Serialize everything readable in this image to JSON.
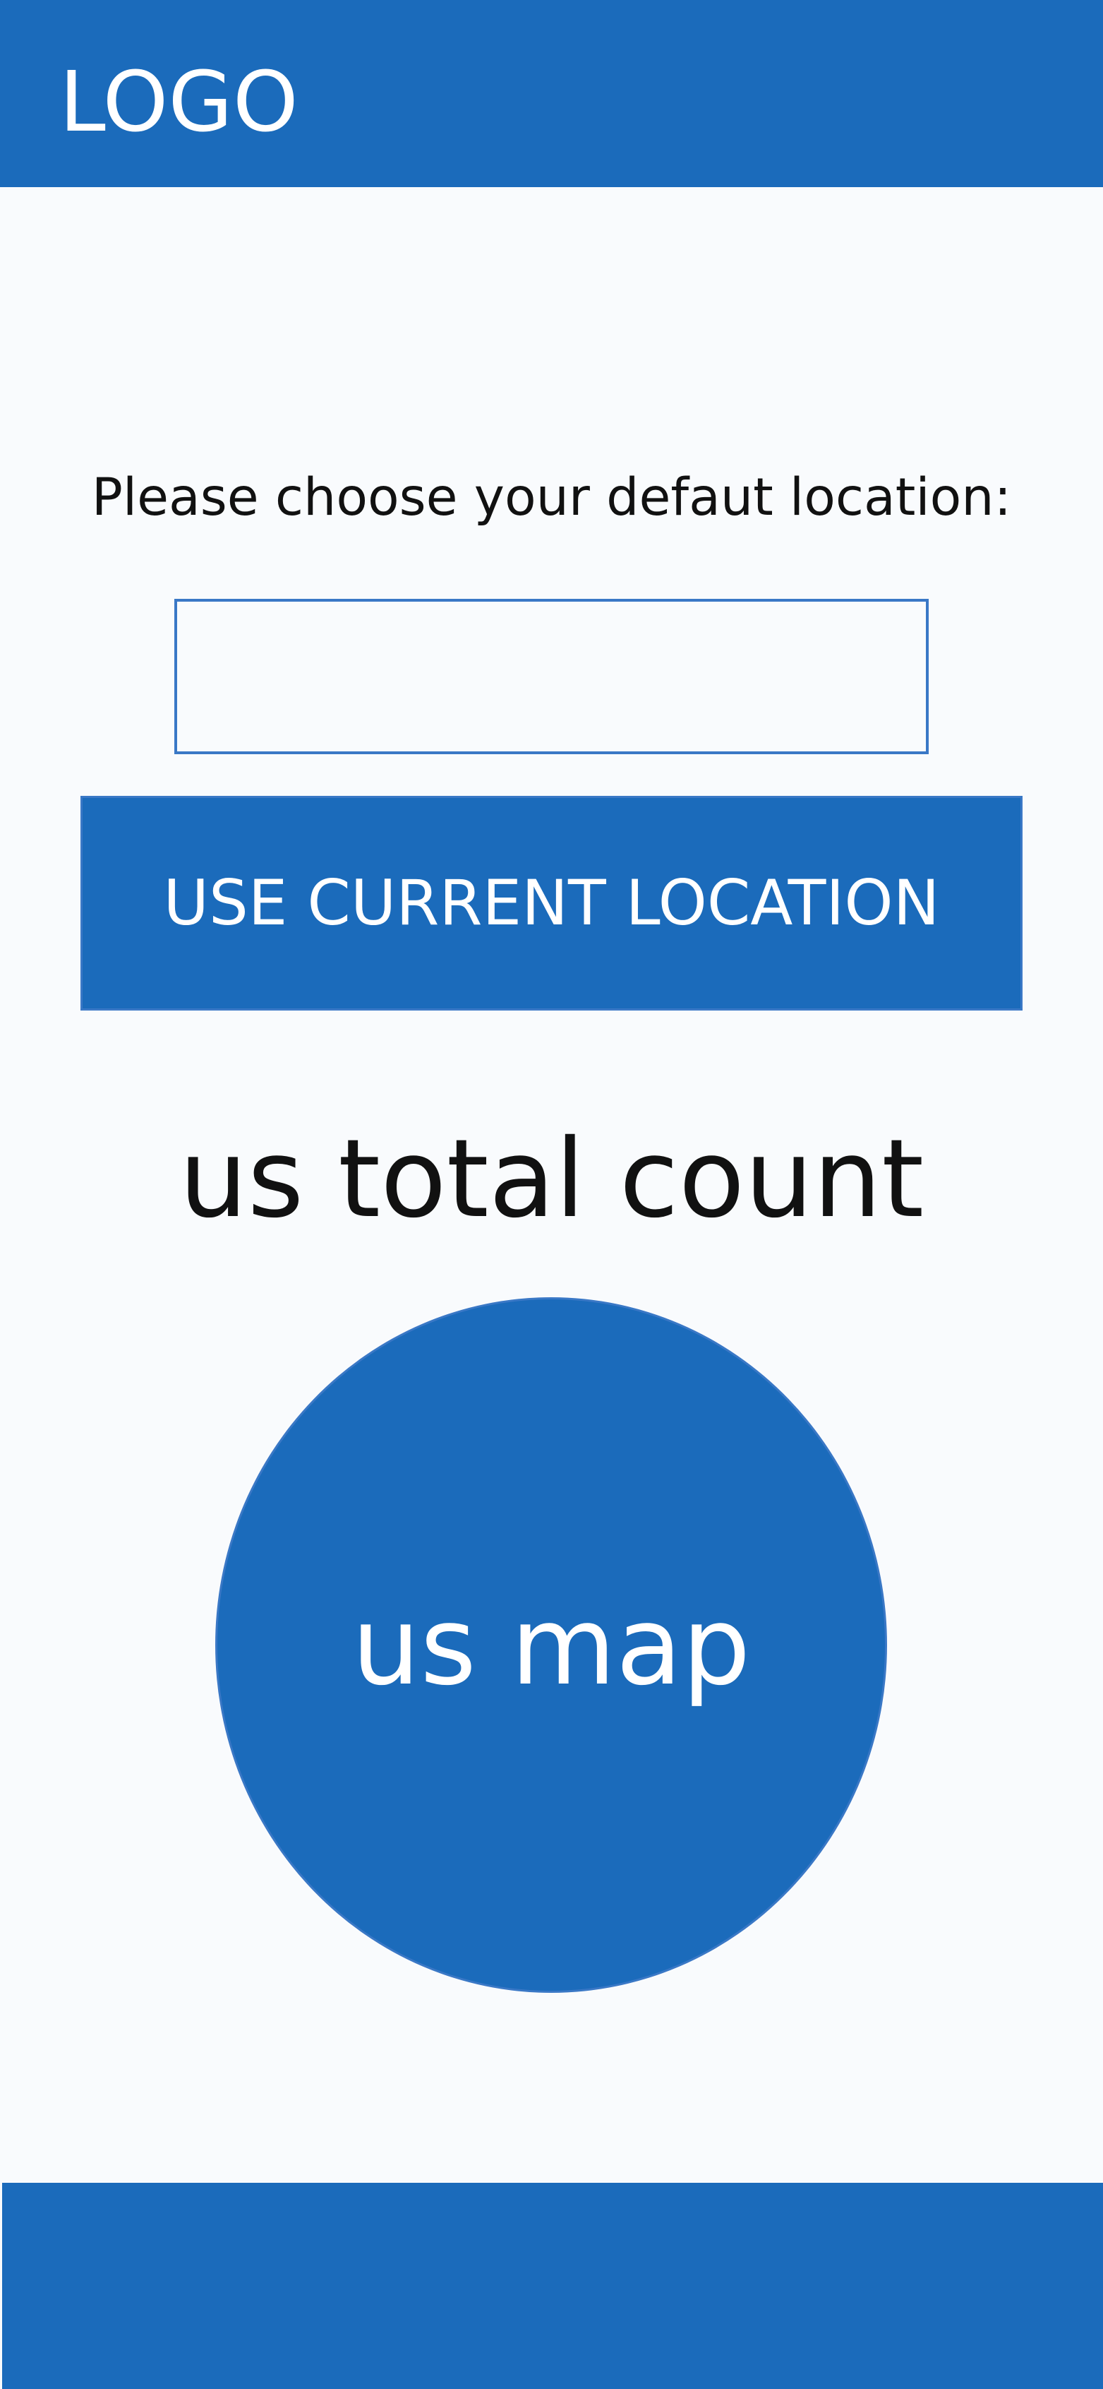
{
  "header": {
    "logo_text": "LOGO"
  },
  "location": {
    "prompt": "Please choose your defaut location:",
    "input_value": "",
    "input_placeholder": "",
    "button_label": "USE CURRENT LOCATION"
  },
  "stats": {
    "total_count_label": "us total count"
  },
  "map": {
    "label": "us map"
  },
  "colors": {
    "primary": "#1b6bbb",
    "border": "#3a78c6",
    "background": "#f9fbfd",
    "text": "#111111"
  }
}
